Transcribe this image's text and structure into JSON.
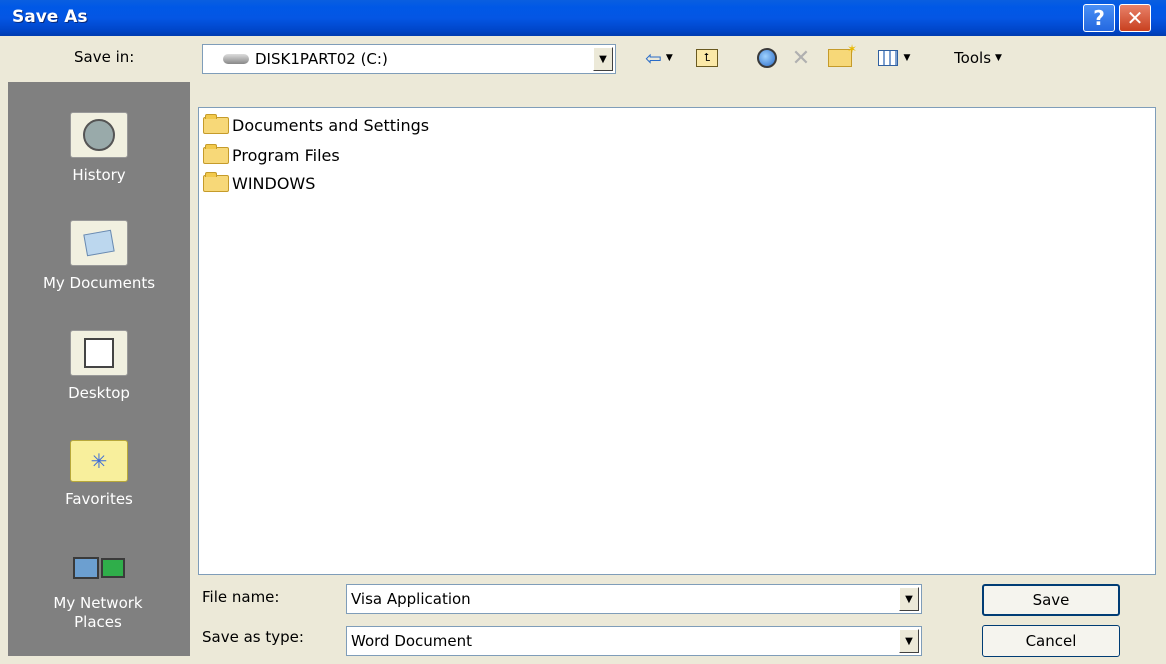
{
  "window": {
    "title": "Save As",
    "help_label": "?",
    "close_label": "✕"
  },
  "toolbar": {
    "save_in_label": "Save in:",
    "location": "DISK1PART02 (C:)",
    "tools_label": "Tools"
  },
  "places": [
    {
      "label": "History"
    },
    {
      "label": "My Documents"
    },
    {
      "label": "Desktop"
    },
    {
      "label": "Favorites"
    },
    {
      "label": "My Network Places"
    }
  ],
  "files": [
    {
      "name": "Documents and Settings",
      "icon": "folder-icon"
    },
    {
      "name": "Program Files",
      "icon": "folder-icon"
    },
    {
      "name": "WINDOWS",
      "icon": "folder-icon"
    }
  ],
  "form": {
    "file_name_label": "File name:",
    "file_name_value": "Visa Application",
    "save_type_label": "Save as type:",
    "save_type_value": "Word Document"
  },
  "buttons": {
    "save": "Save",
    "cancel": "Cancel"
  },
  "colors": {
    "title_bar": "#0058e6",
    "dialog_bg": "#ece9d8",
    "places_bar": "#808080"
  }
}
